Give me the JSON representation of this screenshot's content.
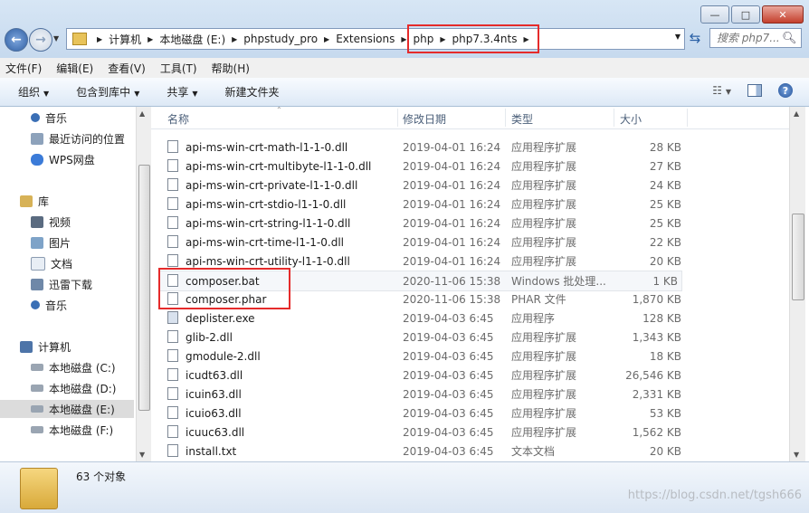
{
  "window": {
    "buttons": [
      "—",
      "□",
      "✕"
    ]
  },
  "address": {
    "path": [
      "计算机",
      "本地磁盘 (E:)",
      "phpstudy_pro",
      "Extensions",
      "php",
      "php7.3.4nts"
    ]
  },
  "search": {
    "placeholder": "搜索 php7..."
  },
  "menu": [
    "文件(F)",
    "编辑(E)",
    "查看(V)",
    "工具(T)",
    "帮助(H)"
  ],
  "toolbar": {
    "organize": "组织",
    "include": "包含到库中",
    "share": "共享",
    "new_folder": "新建文件夹"
  },
  "sidebar": {
    "items": [
      {
        "label": "音乐",
        "icon": "music-icon"
      },
      {
        "label": "最近访问的位置",
        "icon": "recent-places-icon"
      },
      {
        "label": "WPS网盘",
        "icon": "cloud-icon"
      },
      {
        "label": "库",
        "icon": "library-icon"
      },
      {
        "label": "视频",
        "icon": "video-icon"
      },
      {
        "label": "图片",
        "icon": "picture-icon"
      },
      {
        "label": "文档",
        "icon": "document-icon"
      },
      {
        "label": "迅雷下载",
        "icon": "download-icon"
      },
      {
        "label": "音乐",
        "icon": "music-icon"
      },
      {
        "label": "计算机",
        "icon": "computer-icon"
      },
      {
        "label": "本地磁盘 (C:)",
        "icon": "drive-icon"
      },
      {
        "label": "本地磁盘 (D:)",
        "icon": "drive-icon"
      },
      {
        "label": "本地磁盘 (E:)",
        "icon": "drive-icon"
      },
      {
        "label": "本地磁盘 (F:)",
        "icon": "drive-icon"
      }
    ]
  },
  "columns": {
    "name": "名称",
    "date": "修改日期",
    "type": "类型",
    "size": "大小"
  },
  "files": [
    {
      "name": "api-ms-win-crt-math-l1-1-0.dll",
      "date": "2019-04-01 16:24",
      "type": "应用程序扩展",
      "size": "28 KB"
    },
    {
      "name": "api-ms-win-crt-multibyte-l1-1-0.dll",
      "date": "2019-04-01 16:24",
      "type": "应用程序扩展",
      "size": "27 KB"
    },
    {
      "name": "api-ms-win-crt-private-l1-1-0.dll",
      "date": "2019-04-01 16:24",
      "type": "应用程序扩展",
      "size": "24 KB"
    },
    {
      "name": "api-ms-win-crt-stdio-l1-1-0.dll",
      "date": "2019-04-01 16:24",
      "type": "应用程序扩展",
      "size": "25 KB"
    },
    {
      "name": "api-ms-win-crt-string-l1-1-0.dll",
      "date": "2019-04-01 16:24",
      "type": "应用程序扩展",
      "size": "25 KB"
    },
    {
      "name": "api-ms-win-crt-time-l1-1-0.dll",
      "date": "2019-04-01 16:24",
      "type": "应用程序扩展",
      "size": "22 KB"
    },
    {
      "name": "api-ms-win-crt-utility-l1-1-0.dll",
      "date": "2019-04-01 16:24",
      "type": "应用程序扩展",
      "size": "20 KB"
    },
    {
      "name": "composer.bat",
      "date": "2020-11-06 15:38",
      "type": "Windows 批处理...",
      "size": "1 KB"
    },
    {
      "name": "composer.phar",
      "date": "2020-11-06 15:38",
      "type": "PHAR 文件",
      "size": "1,870 KB"
    },
    {
      "name": "deplister.exe",
      "date": "2019-04-03 6:45",
      "type": "应用程序",
      "size": "128 KB"
    },
    {
      "name": "glib-2.dll",
      "date": "2019-04-03 6:45",
      "type": "应用程序扩展",
      "size": "1,343 KB"
    },
    {
      "name": "gmodule-2.dll",
      "date": "2019-04-03 6:45",
      "type": "应用程序扩展",
      "size": "18 KB"
    },
    {
      "name": "icudt63.dll",
      "date": "2019-04-03 6:45",
      "type": "应用程序扩展",
      "size": "26,546 KB"
    },
    {
      "name": "icuin63.dll",
      "date": "2019-04-03 6:45",
      "type": "应用程序扩展",
      "size": "2,331 KB"
    },
    {
      "name": "icuio63.dll",
      "date": "2019-04-03 6:45",
      "type": "应用程序扩展",
      "size": "53 KB"
    },
    {
      "name": "icuuc63.dll",
      "date": "2019-04-03 6:45",
      "type": "应用程序扩展",
      "size": "1,562 KB"
    },
    {
      "name": "install.txt",
      "date": "2019-04-03 6:45",
      "type": "文本文档",
      "size": "20 KB"
    }
  ],
  "status": {
    "count": "63 个对象"
  },
  "watermark": "https://blog.csdn.net/tgsh666",
  "colors": {
    "highlight": "#e52b2b",
    "accent": "#2f5fa3"
  }
}
